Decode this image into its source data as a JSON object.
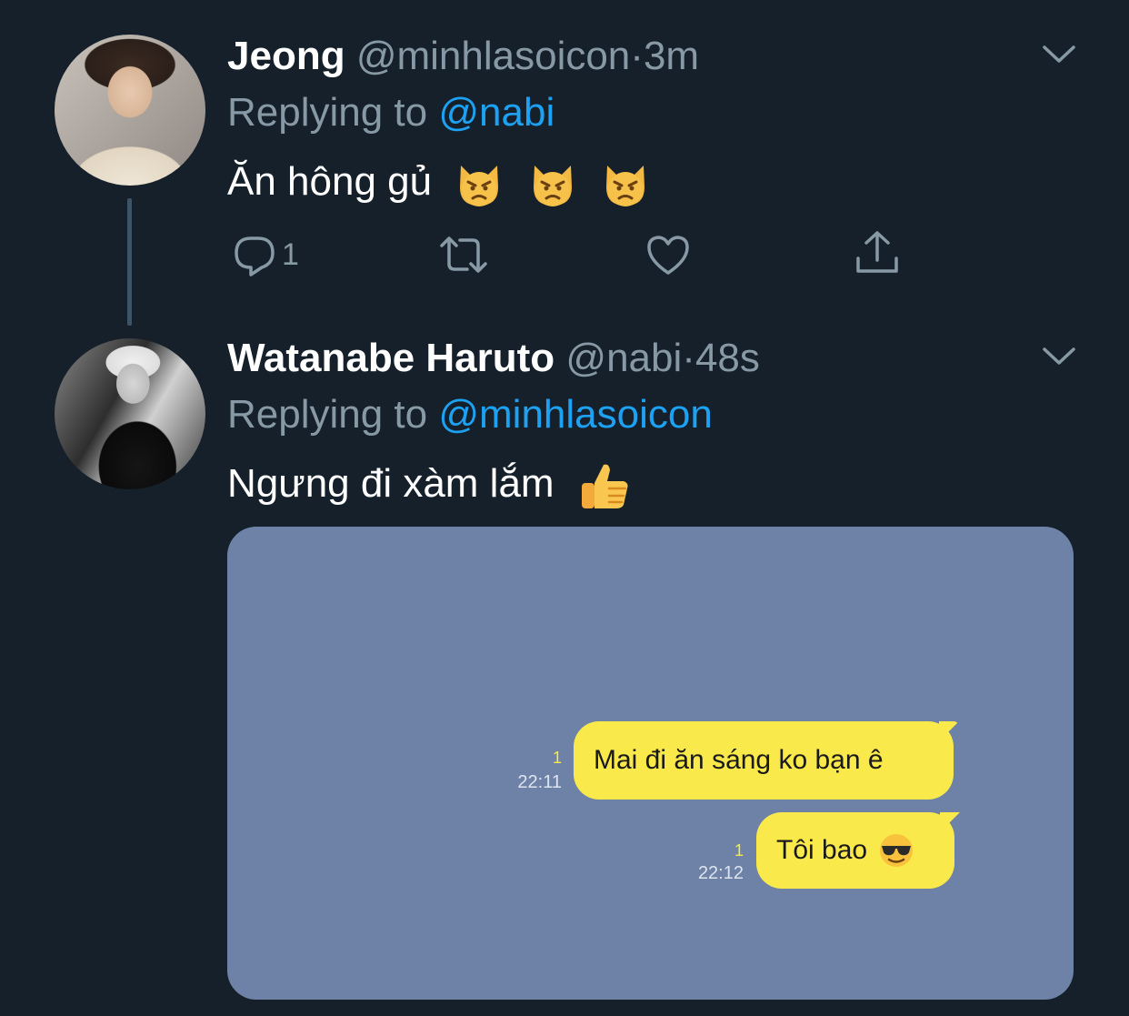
{
  "tweet1": {
    "name": "Jeong",
    "handle": "@minhlasoicon",
    "separator": "·",
    "time": "3m",
    "replying_prefix": "Replying to ",
    "replying_to": "@nabi",
    "text": "Ăn hông gủ",
    "emoji_icons": [
      "pouting-cat-face",
      "pouting-cat-face",
      "pouting-cat-face"
    ],
    "reply_count": "1"
  },
  "tweet2": {
    "name": "Watanabe Haruto",
    "handle": "@nabi",
    "separator": "·",
    "time": "48s",
    "replying_prefix": "Replying to ",
    "replying_to": "@minhlasoicon",
    "text": "Ngưng đi xàm lắm",
    "emoji_icons": [
      "thumbs-up"
    ]
  },
  "chat": {
    "background": "#6d82a6",
    "bubble_color": "#f9e94a",
    "messages": [
      {
        "text": "Mai đi ăn sáng ko bạn ê",
        "read": "1",
        "time": "22:11"
      },
      {
        "text": "Tôi bao",
        "read": "1",
        "time": "22:12",
        "emoji": "smiling-face-with-sunglasses"
      }
    ]
  },
  "colors": {
    "background": "#15202b",
    "secondary_text": "#8899a6",
    "mention": "#1da1f2"
  },
  "icons": [
    "reply-icon",
    "retweet-icon",
    "like-icon",
    "share-icon",
    "chevron-down-icon"
  ]
}
